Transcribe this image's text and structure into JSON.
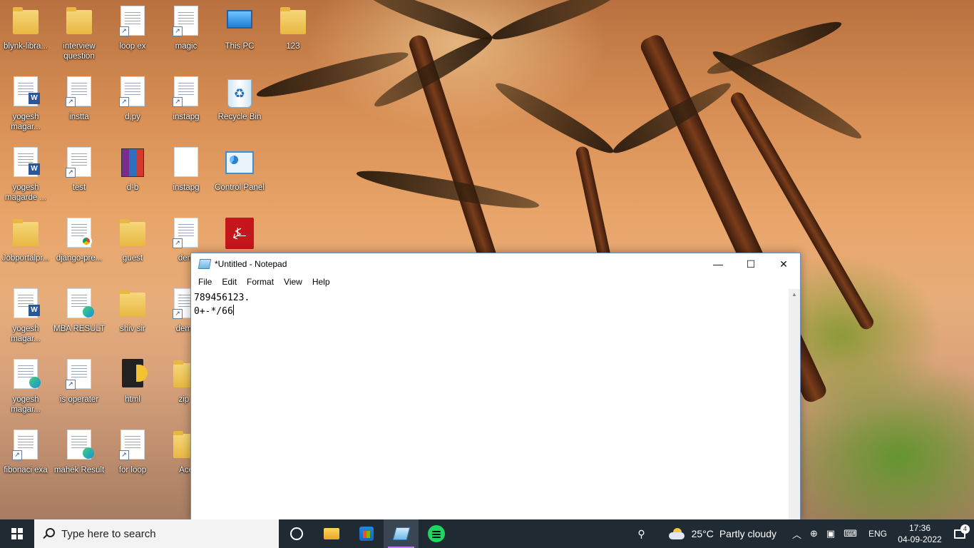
{
  "desktop": {
    "icons": [
      {
        "label": "blynk-libra...",
        "kind": "folder"
      },
      {
        "label": "interview question",
        "kind": "folder"
      },
      {
        "label": "loop ex",
        "kind": "doc"
      },
      {
        "label": "magic",
        "kind": "doc"
      },
      {
        "label": "This PC",
        "kind": "pc"
      },
      {
        "label": "123",
        "kind": "folder"
      },
      {
        "label": "yogesh magar...",
        "kind": "word"
      },
      {
        "label": "instta",
        "kind": "doc"
      },
      {
        "label": "d,py",
        "kind": "doc"
      },
      {
        "label": "instapg",
        "kind": "doc"
      },
      {
        "label": "Recycle Bin",
        "kind": "bin"
      },
      {
        "label": "yogesh magarde ...",
        "kind": "word"
      },
      {
        "label": "test",
        "kind": "doc"
      },
      {
        "label": "d-b",
        "kind": "rar"
      },
      {
        "label": "instapg",
        "kind": "blank"
      },
      {
        "label": "Control Panel",
        "kind": "controlpanel"
      },
      {
        "label": "Jobportalpr...",
        "kind": "folder"
      },
      {
        "label": "django-pre...",
        "kind": "chrome"
      },
      {
        "label": "guest",
        "kind": "folder"
      },
      {
        "label": "dem",
        "kind": "doc"
      },
      {
        "label": "",
        "kind": "pdf"
      },
      {
        "label": "yogesh magar...",
        "kind": "word"
      },
      {
        "label": "MBA RESULT",
        "kind": "edge"
      },
      {
        "label": "shiv sir",
        "kind": "folder"
      },
      {
        "label": "demo",
        "kind": "doc"
      },
      {
        "label": "yogesh magar...",
        "kind": "edge"
      },
      {
        "label": "is operater",
        "kind": "doc"
      },
      {
        "label": "html",
        "kind": "html"
      },
      {
        "label": "zip f",
        "kind": "folder"
      },
      {
        "label": "fibonaci exa",
        "kind": "doc"
      },
      {
        "label": "mahek Result",
        "kind": "edge"
      },
      {
        "label": "for loop",
        "kind": "doc"
      },
      {
        "label": "Ace",
        "kind": "folder"
      }
    ]
  },
  "notepad": {
    "title": "*Untitled - Notepad",
    "menu": [
      "File",
      "Edit",
      "Format",
      "View",
      "Help"
    ],
    "lines": [
      "789456123.",
      "0+-*/66"
    ],
    "buttons": {
      "minimize": "—",
      "maximize": "☐",
      "close": "✕"
    }
  },
  "taskbar": {
    "search_placeholder": "Type here to search",
    "weather": {
      "temp": "25°C",
      "condition": "Partly cloudy"
    },
    "language": "ENG",
    "time": "17:36",
    "date": "04-09-2022",
    "notification_count": "4",
    "pinned": [
      "cortana",
      "file-explorer",
      "microsoft-store",
      "notepad",
      "spotify"
    ],
    "active_app": "notepad"
  }
}
